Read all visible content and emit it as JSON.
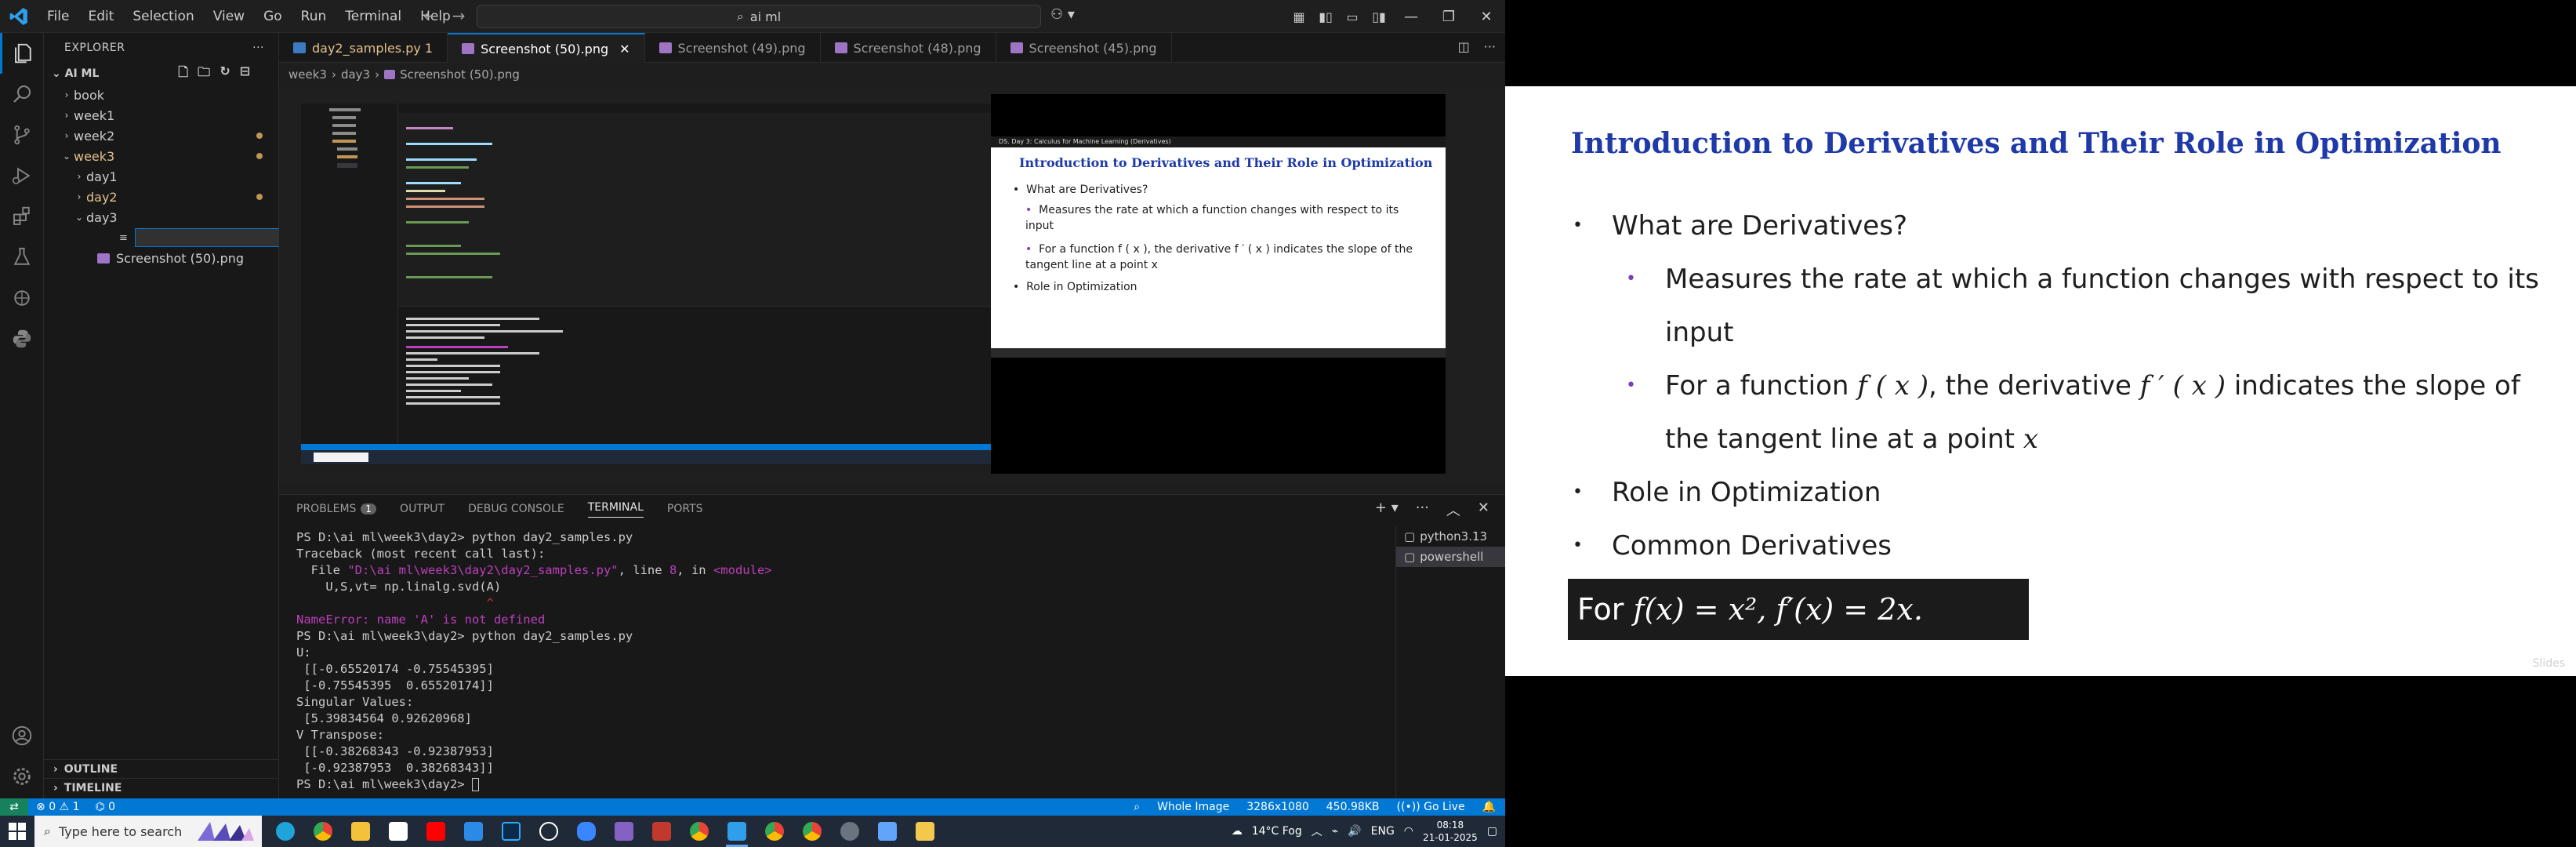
{
  "vscode": {
    "menu": [
      "File",
      "Edit",
      "Selection",
      "View",
      "Go",
      "Run",
      "Terminal",
      "Help"
    ],
    "search": "ai ml",
    "explorer": {
      "title": "EXPLORER",
      "root": "AI ML",
      "items": [
        {
          "label": "book",
          "chev": "›"
        },
        {
          "label": "week1",
          "chev": "›"
        },
        {
          "label": "week2",
          "chev": "›"
        },
        {
          "label": "week3",
          "chev": "⌄"
        },
        {
          "label": "day1",
          "chev": "›"
        },
        {
          "label": "day2",
          "chev": "›"
        },
        {
          "label": "day3",
          "chev": "⌄"
        },
        {
          "label": "Screenshot (50).png",
          "chev": ""
        }
      ],
      "outline": "OUTLINE",
      "timeline": "TIMELINE"
    },
    "tabs": [
      {
        "label": "day2_samples.py 1"
      },
      {
        "label": "Screenshot (50).png"
      },
      {
        "label": "Screenshot (49).png"
      },
      {
        "label": "Screenshot (48).png"
      },
      {
        "label": "Screenshot (45).png"
      }
    ],
    "breadcrumb": [
      "week3",
      "day3",
      "Screenshot (50).png"
    ],
    "panel": {
      "tabs": [
        "PROBLEMS",
        "OUTPUT",
        "DEBUG CONSOLE",
        "TERMINAL",
        "PORTS"
      ],
      "problems_count": "1",
      "terminals": [
        "python3.13",
        "powershell"
      ]
    },
    "terminal": [
      "PS D:\\ai ml\\week3\\day2> python day2_samples.py",
      "Traceback (most recent call last):",
      "  File \"D:\\ai ml\\week3\\day2\\day2_samples.py\", line 8, in <module>",
      "    U,S,vt= np.linalg.svd(A)",
      "                          ^",
      "NameError: name 'A' is not defined",
      "PS D:\\ai ml\\week3\\day2> python day2_samples.py",
      "U:",
      " [[-0.65520174 -0.75545395]",
      " [-0.75545395  0.65520174]]",
      "Singular Values:",
      " [5.39834564 0.92620968]",
      "V Transpose:",
      " [[-0.38268343 -0.92387953]",
      " [-0.92387953  0.38268343]]",
      "PS D:\\ai ml\\week3\\day2> "
    ],
    "status": {
      "errors": "0",
      "warnings": "1",
      "info": "0",
      "image_type": "Whole Image",
      "dimensions": "3286x1080",
      "size": "450.98KB",
      "golive": "Go Live"
    }
  },
  "nested": {
    "slide_header": "DS. Day 3: Calculus for Machine Learning (Derivatives)",
    "title": "Introduction to Derivatives and Their Role in Optimization",
    "b1": "What are Derivatives?",
    "b1a": "Measures the rate at which a function changes with respect to its input",
    "b1b": "For a function f ( x ), the derivative f ′ ( x ) indicates the slope of the tangent line at a point x",
    "b2": "Role in Optimization"
  },
  "slide": {
    "title": "Introduction to Derivatives and Their Role in Optimization",
    "b1": "What are Derivatives?",
    "b1a_line1": "Measures the rate at which a function changes with respect to its",
    "b1a_line2": "input",
    "b1b_pre": "For a function ",
    "b1b_f": "f",
    "b1b_x": "( x )",
    "b1b_mid": ", the derivative ",
    "b1b_fp": "f ′",
    "b1b_x2": " ( x )",
    "b1b_post": " indicates the slope of",
    "b1b_line2a": "the tangent line at a point ",
    "b1b_line2x": "x",
    "b2": "Role in Optimization",
    "b3": "Common Derivatives",
    "formula_for": "For ",
    "formula_math": "f(x) = x², f′(x) = 2x.",
    "watermark": "Slides"
  },
  "taskbar": {
    "search_placeholder": "Type here to search",
    "weather": "14°C  Fog",
    "lang": "ENG",
    "time": "08:18",
    "date": "21-01-2025"
  }
}
